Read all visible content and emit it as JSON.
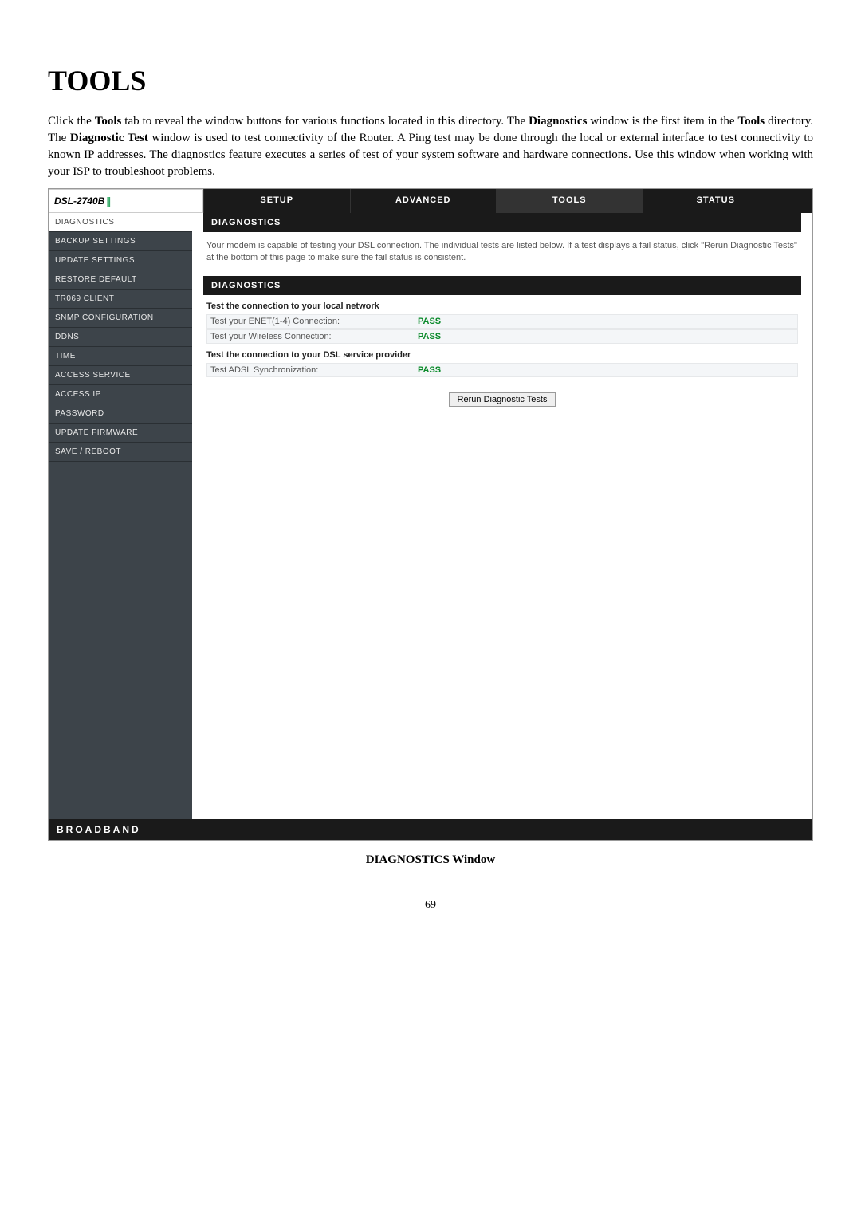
{
  "page": {
    "title": "TOOLS",
    "intro_html": "Click the <b>Tools</b> tab to reveal the window buttons for various functions located in this directory. The <b>Diagnostics</b> window is the first item in the <b>Tools</b> directory. The <b>Diagnostic Test</b> window is used to test connectivity of the Router. A Ping test may be done through the local or external interface to test connectivity to known IP addresses. The diagnostics feature executes a series of test of your system software and hardware connections. Use this window when working with your ISP to troubleshoot problems.",
    "caption": "DIAGNOSTICS Window",
    "number": "69"
  },
  "router": {
    "product": "DSL-2740B",
    "tabs": {
      "setup": "SETUP",
      "advanced": "ADVANCED",
      "tools": "TOOLS",
      "status": "STATUS"
    },
    "sidebar": [
      "DIAGNOSTICS",
      "BACKUP SETTINGS",
      "UPDATE SETTINGS",
      "RESTORE DEFAULT",
      "TR069 CLIENT",
      "SNMP CONFIGURATION",
      "DDNS",
      "TIME",
      "ACCESS SERVICE",
      "ACCESS IP",
      "PASSWORD",
      "UPDATE FIRMWARE",
      "SAVE / REBOOT"
    ],
    "panels": {
      "diag1_title": "DIAGNOSTICS",
      "diag1_desc": "Your modem is capable of testing your DSL connection. The individual tests are listed below. If a test displays a fail status, click \"Rerun Diagnostic Tests\" at the bottom of this page to make sure the fail status is consistent.",
      "diag2_title": "DIAGNOSTICS",
      "section_local": "Test the connection to your local network",
      "tests_local": [
        {
          "label": "Test your ENET(1-4) Connection:",
          "result": "PASS"
        },
        {
          "label": "Test your Wireless Connection:",
          "result": "PASS"
        }
      ],
      "section_dsl": "Test the connection to your DSL service provider",
      "tests_dsl": [
        {
          "label": "Test ADSL Synchronization:",
          "result": "PASS"
        }
      ],
      "rerun_button": "Rerun Diagnostic Tests"
    },
    "footer": "BROADBAND"
  }
}
